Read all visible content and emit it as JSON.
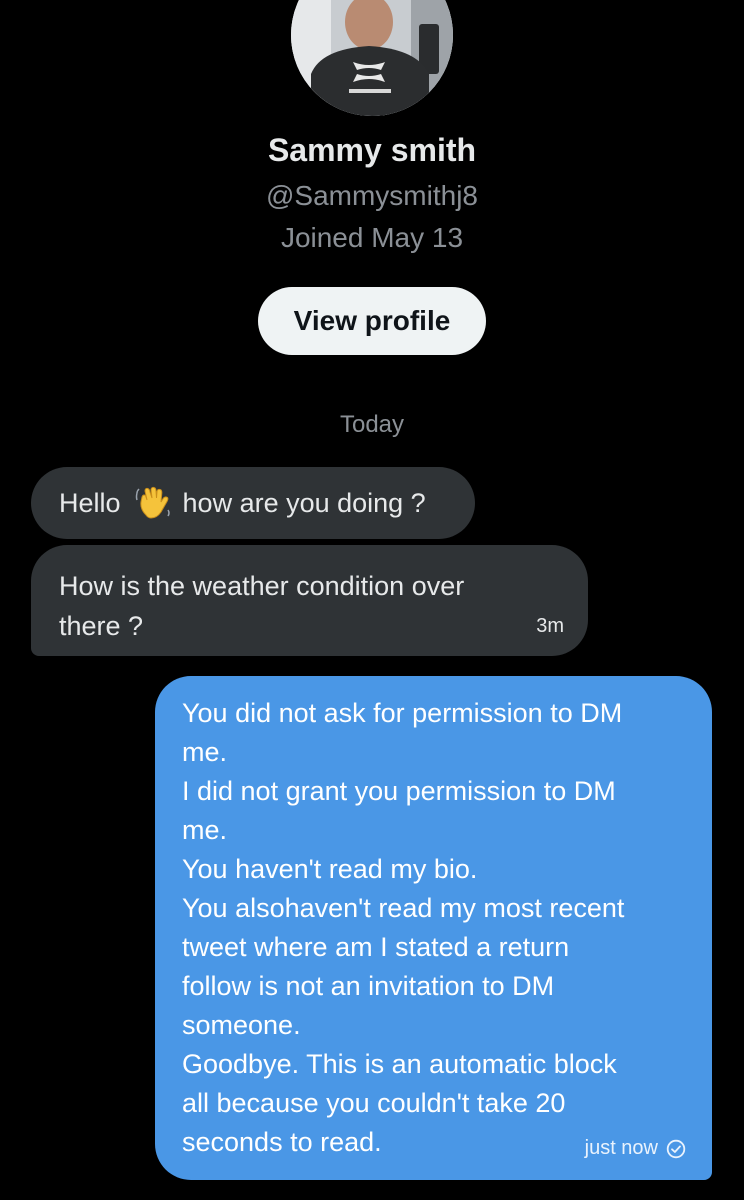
{
  "profile": {
    "name": "Sammy smith",
    "handle": "@Sammysmithj8",
    "joined": "Joined May 13",
    "view_profile_label": "View profile"
  },
  "date_separator": "Today",
  "messages_received": [
    {
      "text_before": "Hello",
      "emoji": "waving-hand-icon",
      "text_after": "how are you doing ?"
    },
    {
      "text": "How is the weather condition over there ?",
      "time": "3m"
    }
  ],
  "message_sent": {
    "lines": [
      "You did not ask for permission to DM",
      "me.",
      "I did not grant you permission to DM",
      "me.",
      "You haven't read my bio.",
      "You alsohaven't read my most recent",
      "tweet where am I stated a return",
      "follow is not an invitation to DM",
      "someone.",
      "Goodbye. This is an automatic block",
      "all because you couldn't take 20",
      "seconds to read."
    ],
    "time": "just now",
    "status_icon": "check-circle-icon"
  },
  "colors": {
    "background": "#000000",
    "received_bubble": "#2f3336",
    "sent_bubble": "#4a97e6",
    "button_bg": "#eff3f4",
    "muted_text": "#8b9096"
  }
}
